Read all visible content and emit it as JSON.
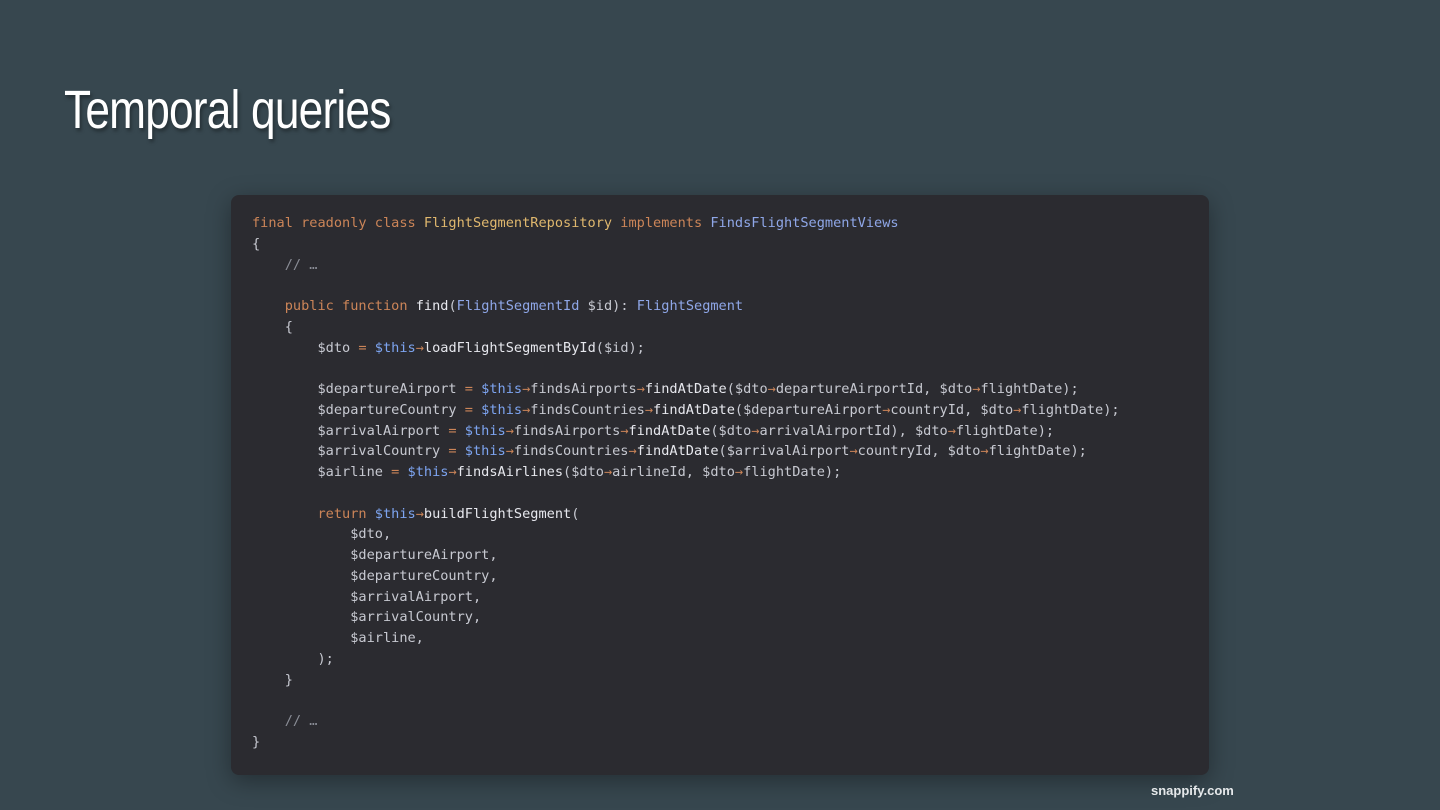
{
  "slide": {
    "title": "Temporal queries"
  },
  "code": {
    "language": "php",
    "lines": [
      [
        {
          "t": "final readonly class ",
          "c": "keyword"
        },
        {
          "t": "FlightSegmentRepository",
          "c": "type"
        },
        {
          "t": " implements ",
          "c": "keyword"
        },
        {
          "t": "FindsFlightSegmentViews",
          "c": "class"
        }
      ],
      [
        {
          "t": "{",
          "c": "punct"
        }
      ],
      [
        {
          "t": "    ",
          "c": "punct"
        },
        {
          "t": "// …",
          "c": "comment"
        }
      ],
      [],
      [
        {
          "t": "    ",
          "c": "punct"
        },
        {
          "t": "public function ",
          "c": "keyword"
        },
        {
          "t": "find",
          "c": "func"
        },
        {
          "t": "(",
          "c": "punct"
        },
        {
          "t": "FlightSegmentId",
          "c": "class"
        },
        {
          "t": " $id",
          "c": "var"
        },
        {
          "t": "): ",
          "c": "punct"
        },
        {
          "t": "FlightSegment",
          "c": "class"
        }
      ],
      [
        {
          "t": "    {",
          "c": "punct"
        }
      ],
      [
        {
          "t": "        $dto ",
          "c": "var"
        },
        {
          "t": "=",
          "c": "op"
        },
        {
          "t": " ",
          "c": "punct"
        },
        {
          "t": "$this",
          "c": "this"
        },
        {
          "t": "→",
          "c": "arrow"
        },
        {
          "t": "loadFlightSegmentById",
          "c": "func"
        },
        {
          "t": "($id);",
          "c": "punct"
        }
      ],
      [],
      [
        {
          "t": "        $departureAirport ",
          "c": "var"
        },
        {
          "t": "=",
          "c": "op"
        },
        {
          "t": " ",
          "c": "punct"
        },
        {
          "t": "$this",
          "c": "this"
        },
        {
          "t": "→",
          "c": "arrow"
        },
        {
          "t": "findsAirports",
          "c": "prop"
        },
        {
          "t": "→",
          "c": "arrow"
        },
        {
          "t": "findAtDate",
          "c": "func"
        },
        {
          "t": "($dto",
          "c": "punct"
        },
        {
          "t": "→",
          "c": "arrow"
        },
        {
          "t": "departureAirportId, $dto",
          "c": "prop"
        },
        {
          "t": "→",
          "c": "arrow"
        },
        {
          "t": "flightDate);",
          "c": "prop"
        }
      ],
      [
        {
          "t": "        $departureCountry ",
          "c": "var"
        },
        {
          "t": "=",
          "c": "op"
        },
        {
          "t": " ",
          "c": "punct"
        },
        {
          "t": "$this",
          "c": "this"
        },
        {
          "t": "→",
          "c": "arrow"
        },
        {
          "t": "findsCountries",
          "c": "prop"
        },
        {
          "t": "→",
          "c": "arrow"
        },
        {
          "t": "findAtDate",
          "c": "func"
        },
        {
          "t": "($departureAirport",
          "c": "punct"
        },
        {
          "t": "→",
          "c": "arrow"
        },
        {
          "t": "countryId, $dto",
          "c": "prop"
        },
        {
          "t": "→",
          "c": "arrow"
        },
        {
          "t": "flightDate);",
          "c": "prop"
        }
      ],
      [
        {
          "t": "        $arrivalAirport ",
          "c": "var"
        },
        {
          "t": "=",
          "c": "op"
        },
        {
          "t": " ",
          "c": "punct"
        },
        {
          "t": "$this",
          "c": "this"
        },
        {
          "t": "→",
          "c": "arrow"
        },
        {
          "t": "findsAirports",
          "c": "prop"
        },
        {
          "t": "→",
          "c": "arrow"
        },
        {
          "t": "findAtDate",
          "c": "func"
        },
        {
          "t": "($dto",
          "c": "punct"
        },
        {
          "t": "→",
          "c": "arrow"
        },
        {
          "t": "arrivalAirportId), $dto",
          "c": "prop"
        },
        {
          "t": "→",
          "c": "arrow"
        },
        {
          "t": "flightDate);",
          "c": "prop"
        }
      ],
      [
        {
          "t": "        $arrivalCountry ",
          "c": "var"
        },
        {
          "t": "=",
          "c": "op"
        },
        {
          "t": " ",
          "c": "punct"
        },
        {
          "t": "$this",
          "c": "this"
        },
        {
          "t": "→",
          "c": "arrow"
        },
        {
          "t": "findsCountries",
          "c": "prop"
        },
        {
          "t": "→",
          "c": "arrow"
        },
        {
          "t": "findAtDate",
          "c": "func"
        },
        {
          "t": "($arrivalAirport",
          "c": "punct"
        },
        {
          "t": "→",
          "c": "arrow"
        },
        {
          "t": "countryId, $dto",
          "c": "prop"
        },
        {
          "t": "→",
          "c": "arrow"
        },
        {
          "t": "flightDate);",
          "c": "prop"
        }
      ],
      [
        {
          "t": "        $airline ",
          "c": "var"
        },
        {
          "t": "=",
          "c": "op"
        },
        {
          "t": " ",
          "c": "punct"
        },
        {
          "t": "$this",
          "c": "this"
        },
        {
          "t": "→",
          "c": "arrow"
        },
        {
          "t": "findsAirlines",
          "c": "func"
        },
        {
          "t": "($dto",
          "c": "punct"
        },
        {
          "t": "→",
          "c": "arrow"
        },
        {
          "t": "airlineId, $dto",
          "c": "prop"
        },
        {
          "t": "→",
          "c": "arrow"
        },
        {
          "t": "flightDate);",
          "c": "prop"
        }
      ],
      [],
      [
        {
          "t": "        ",
          "c": "punct"
        },
        {
          "t": "return ",
          "c": "keyword"
        },
        {
          "t": "$this",
          "c": "this"
        },
        {
          "t": "→",
          "c": "arrow"
        },
        {
          "t": "buildFlightSegment",
          "c": "func"
        },
        {
          "t": "(",
          "c": "punct"
        }
      ],
      [
        {
          "t": "            $dto,",
          "c": "var"
        }
      ],
      [
        {
          "t": "            $departureAirport,",
          "c": "var"
        }
      ],
      [
        {
          "t": "            $departureCountry,",
          "c": "var"
        }
      ],
      [
        {
          "t": "            $arrivalAirport,",
          "c": "var"
        }
      ],
      [
        {
          "t": "            $arrivalCountry,",
          "c": "var"
        }
      ],
      [
        {
          "t": "            $airline,",
          "c": "var"
        }
      ],
      [
        {
          "t": "        );",
          "c": "punct"
        }
      ],
      [
        {
          "t": "    }",
          "c": "punct"
        }
      ],
      [],
      [
        {
          "t": "    ",
          "c": "punct"
        },
        {
          "t": "// …",
          "c": "comment"
        }
      ],
      [
        {
          "t": "}",
          "c": "punct"
        }
      ]
    ]
  },
  "watermark": {
    "text": "snappify.com"
  },
  "colors": {
    "background": "#37474f",
    "code_background": "#2b2b30",
    "keyword": "#cc8558",
    "type": "#e0b86e",
    "class": "#8fa7e8",
    "this": "#7da4f0",
    "comment": "#8a8d96",
    "text": "#c7c9d1"
  }
}
